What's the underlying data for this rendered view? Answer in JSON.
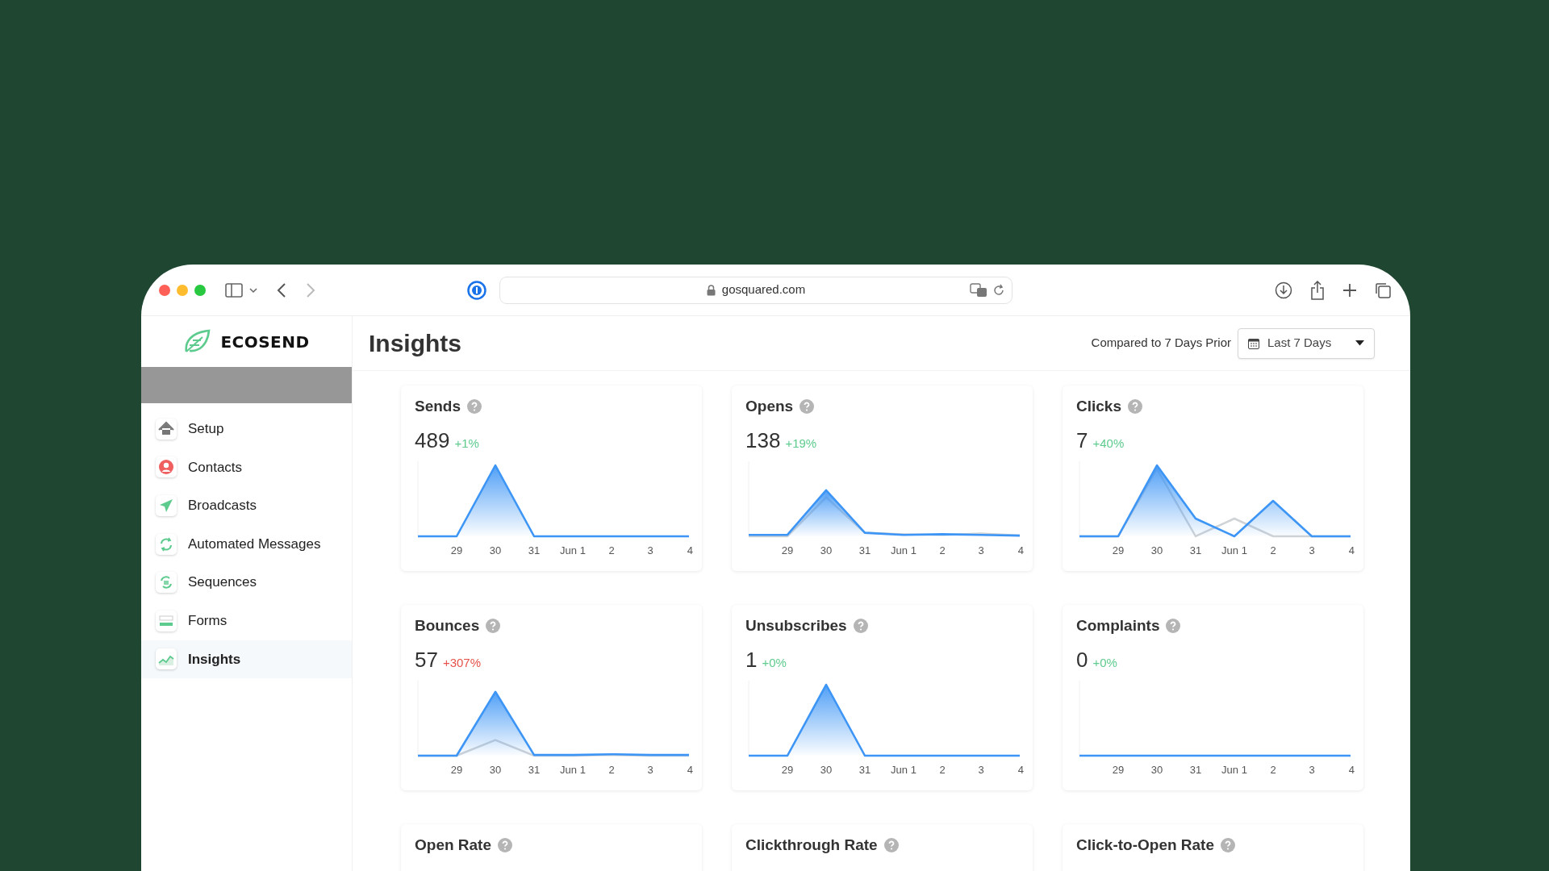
{
  "browser": {
    "url": "gosquared.com"
  },
  "sidebar": {
    "logo": "ECOSEND",
    "items": [
      {
        "label": "Setup",
        "kind": "home",
        "selected": false
      },
      {
        "label": "Contacts",
        "kind": "person",
        "selected": false
      },
      {
        "label": "Broadcasts",
        "kind": "send",
        "selected": false
      },
      {
        "label": "Automated Messages",
        "kind": "cycle",
        "selected": false
      },
      {
        "label": "Sequences",
        "kind": "sequence",
        "selected": false
      },
      {
        "label": "Forms",
        "kind": "form",
        "selected": false
      },
      {
        "label": "Insights",
        "kind": "chart",
        "selected": true
      }
    ]
  },
  "header": {
    "title": "Insights",
    "comparison": "Compared to 7 Days Prior",
    "date_range": "Last 7 Days"
  },
  "cards": [
    {
      "title": "Sends",
      "value": "489",
      "change": "+1%",
      "color": "#5ecb8e",
      "x_labels": [
        "29",
        "30",
        "31",
        "Jun 1",
        "2",
        "3",
        "4"
      ]
    },
    {
      "title": "Opens",
      "value": "138",
      "change": "+19%",
      "color": "#5ecb8e",
      "x_labels": [
        "29",
        "30",
        "31",
        "Jun 1",
        "2",
        "3",
        "4"
      ]
    },
    {
      "title": "Clicks",
      "value": "7",
      "change": "+40%",
      "color": "#5ecb8e",
      "x_labels": [
        "29",
        "30",
        "31",
        "Jun 1",
        "2",
        "3",
        "4"
      ]
    },
    {
      "title": "Bounces",
      "value": "57",
      "change": "+307%",
      "color": "#e5534b",
      "x_labels": [
        "29",
        "30",
        "31",
        "Jun 1",
        "2",
        "3",
        "4"
      ]
    },
    {
      "title": "Unsubscribes",
      "value": "1",
      "change": "+0%",
      "color": "#5ecb8e",
      "x_labels": [
        "29",
        "30",
        "31",
        "Jun 1",
        "2",
        "3",
        "4"
      ]
    },
    {
      "title": "Complaints",
      "value": "0",
      "change": "+0%",
      "color": "#5ecb8e",
      "x_labels": [
        "29",
        "30",
        "31",
        "Jun 1",
        "2",
        "3",
        "4"
      ]
    },
    {
      "title": "Open Rate"
    },
    {
      "title": "Clickthrough Rate"
    },
    {
      "title": "Click-to-Open Rate"
    }
  ]
}
